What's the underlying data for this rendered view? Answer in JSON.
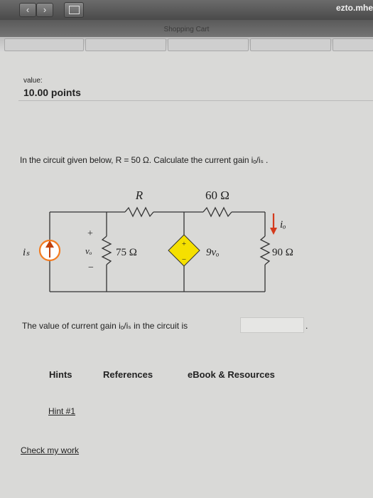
{
  "browser": {
    "back_glyph": "‹",
    "forward_glyph": "›",
    "url": "ezto.mhe",
    "tab_title": "Shopping Cart"
  },
  "question": {
    "value_label": "value:",
    "points": "10.00 points",
    "prompt": "In the circuit given below, R = 50 Ω. Calculate the current gain iₒ/iₛ .",
    "answer_prefix": "The value of current gain iₒ/iₛ in the circuit is",
    "answer_value": "",
    "answer_suffix": "."
  },
  "circuit": {
    "r_label": "R",
    "r60_label": "60 Ω",
    "r75_label": "75 Ω",
    "r90_label": "90 Ω",
    "source_label": "iₛ",
    "vo_label": "vₒ",
    "plus_label": "+",
    "minus_label": "−",
    "dep_label": "9vₒ",
    "io_label": "iₒ"
  },
  "tabs": [
    "Hints",
    "References",
    "eBook & Resources"
  ],
  "links": {
    "hint": "Hint #1",
    "check": "Check my work"
  },
  "colors": {
    "source_orange": "#f47c20",
    "arrow_red": "#d43a1c",
    "dependent_fill": "#f5e000"
  }
}
